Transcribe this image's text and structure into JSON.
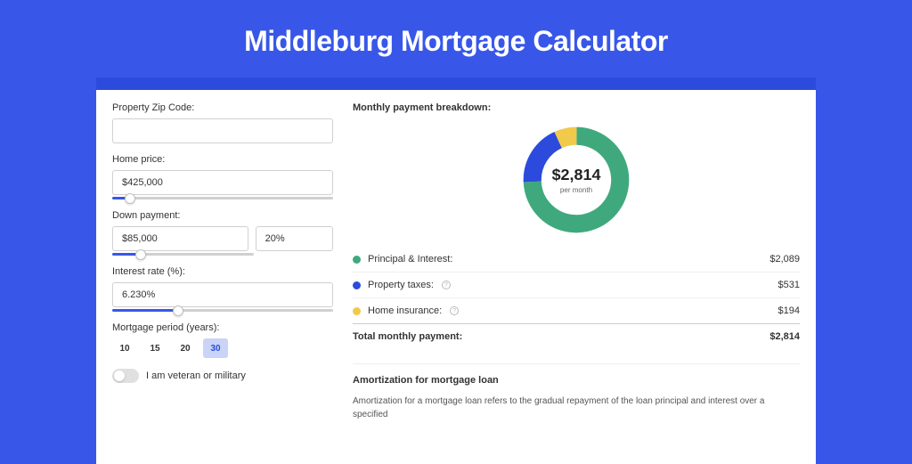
{
  "page_title": "Middleburg Mortgage Calculator",
  "form": {
    "zip": {
      "label": "Property Zip Code:",
      "value": ""
    },
    "price": {
      "label": "Home price:",
      "value": "$425,000",
      "slider_pct": 8
    },
    "down": {
      "label": "Down payment:",
      "amount": "$85,000",
      "pct": "20%",
      "slider_pct": 20
    },
    "rate": {
      "label": "Interest rate (%):",
      "value": "6.230%",
      "slider_pct": 30
    },
    "period": {
      "label": "Mortgage period (years):",
      "options": [
        "10",
        "15",
        "20",
        "30"
      ],
      "selected": "30"
    },
    "veteran": {
      "label": "I am veteran or military",
      "on": false
    }
  },
  "breakdown": {
    "heading": "Monthly payment breakdown:",
    "center_amount": "$2,814",
    "center_sub": "per month",
    "items": [
      {
        "label": "Principal & Interest:",
        "value": "$2,089",
        "color": "#3fa97d",
        "info": false
      },
      {
        "label": "Property taxes:",
        "value": "$531",
        "color": "#2c4bdc",
        "info": true
      },
      {
        "label": "Home insurance:",
        "value": "$194",
        "color": "#f1c94b",
        "info": true
      }
    ],
    "total": {
      "label": "Total monthly payment:",
      "value": "$2,814"
    }
  },
  "amortization": {
    "heading": "Amortization for mortgage loan",
    "text": "Amortization for a mortgage loan refers to the gradual repayment of the loan principal and interest over a specified"
  },
  "colors": {
    "accent": "#3857e8"
  },
  "chart_data": {
    "type": "pie",
    "title": "Monthly payment breakdown",
    "categories": [
      "Principal & Interest",
      "Property taxes",
      "Home insurance"
    ],
    "values": [
      2089,
      531,
      194
    ],
    "colors": [
      "#3fa97d",
      "#2c4bdc",
      "#f1c94b"
    ],
    "center_label": "$2,814 per month"
  }
}
